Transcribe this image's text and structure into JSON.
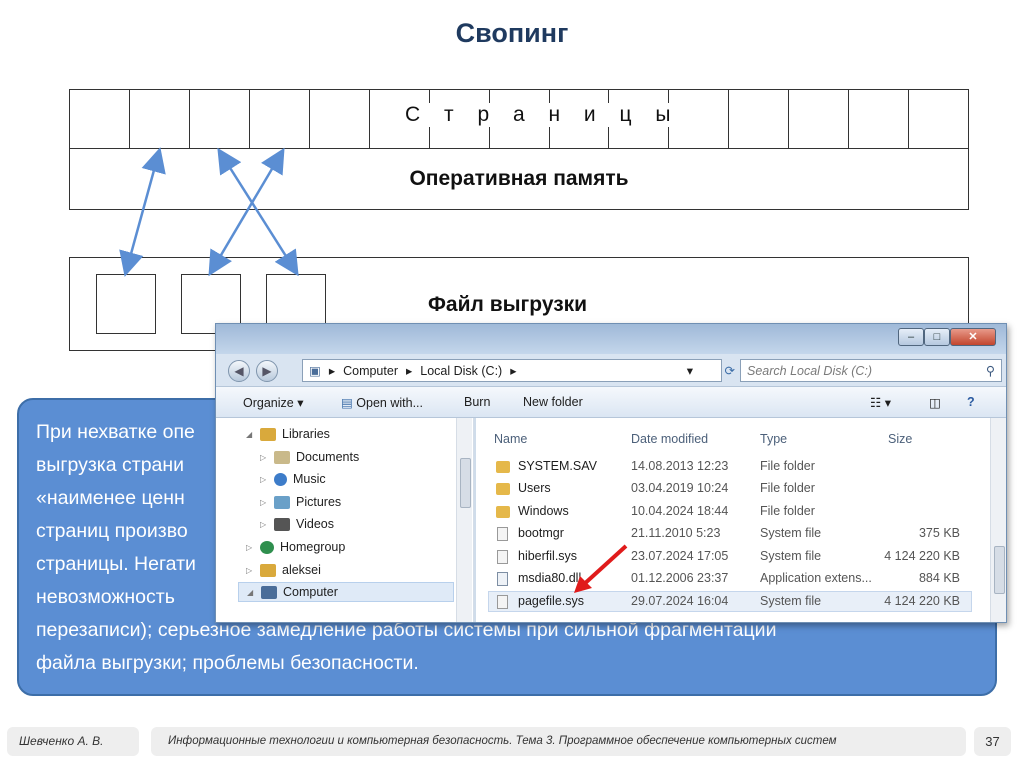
{
  "slide": {
    "title": "Свопинг",
    "pages_label": "С т р а н и ц ы",
    "ram_label": "Оперативная память",
    "swap_label": "Файл выгрузки"
  },
  "text_panel": {
    "lines": [
      "При нехватке опе",
      "выгрузка страни",
      "«наименее ценн",
      "страниц произво",
      "страницы. Негати",
      "невозможность",
      "перезаписи); серьезное замедление работы системы при сильной фрагментации",
      "файла выгрузки; проблемы безопасности."
    ]
  },
  "explorer": {
    "address": [
      "Computer",
      "Local Disk (C:)"
    ],
    "search_placeholder": "Search Local Disk (C:)",
    "toolbar": {
      "organize": "Organize",
      "open_with": "Open with...",
      "burn": "Burn",
      "new_folder": "New folder"
    },
    "tree": [
      {
        "label": "Libraries",
        "icon": "libraries-icon",
        "color": "#d9a93c"
      },
      {
        "label": "Documents",
        "icon": "documents-icon",
        "color": "#c9b98a"
      },
      {
        "label": "Music",
        "icon": "music-icon",
        "color": "#3d7cc9"
      },
      {
        "label": "Pictures",
        "icon": "pictures-icon",
        "color": "#6aa0c8"
      },
      {
        "label": "Videos",
        "icon": "videos-icon",
        "color": "#555555"
      },
      {
        "label": "Homegroup",
        "icon": "homegroup-icon",
        "color": "#2f8f4e"
      },
      {
        "label": "aleksei",
        "icon": "user-folder-icon",
        "color": "#d9a93c"
      },
      {
        "label": "Computer",
        "icon": "computer-icon",
        "color": "#4a6d99"
      }
    ],
    "columns": {
      "name": "Name",
      "date": "Date modified",
      "type": "Type",
      "size": "Size"
    },
    "files": [
      {
        "name": "SYSTEM.SAV",
        "date": "14.08.2013 12:23",
        "type": "File folder",
        "size": "",
        "icon": "folder-icon"
      },
      {
        "name": "Users",
        "date": "03.04.2019 10:24",
        "type": "File folder",
        "size": "",
        "icon": "folder-icon"
      },
      {
        "name": "Windows",
        "date": "10.04.2024 18:44",
        "type": "File folder",
        "size": "",
        "icon": "folder-icon"
      },
      {
        "name": "bootmgr",
        "date": "21.11.2010 5:23",
        "type": "System file",
        "size": "375 KB",
        "icon": "system-file-icon"
      },
      {
        "name": "hiberfil.sys",
        "date": "23.07.2024 17:05",
        "type": "System file",
        "size": "4 124 220 KB",
        "icon": "system-file-icon"
      },
      {
        "name": "msdia80.dll",
        "date": "01.12.2006 23:37",
        "type": "Application extens...",
        "size": "884 KB",
        "icon": "dll-file-icon"
      },
      {
        "name": "pagefile.sys",
        "date": "29.07.2024 16:04",
        "type": "System file",
        "size": "4 124 220 KB",
        "icon": "system-file-icon"
      }
    ]
  },
  "footer": {
    "author": "Шевченко А. В.",
    "course": "Информационные технологии и компьютерная безопасность. Тема 3. Программное обеспечение компьютерных систем",
    "page": "37"
  },
  "colors": {
    "panel_bg": "#5b8ed3",
    "arrow": "#5b8ed3",
    "title": "#1f3a5f",
    "highlight_arrow": "#e01b1b"
  }
}
